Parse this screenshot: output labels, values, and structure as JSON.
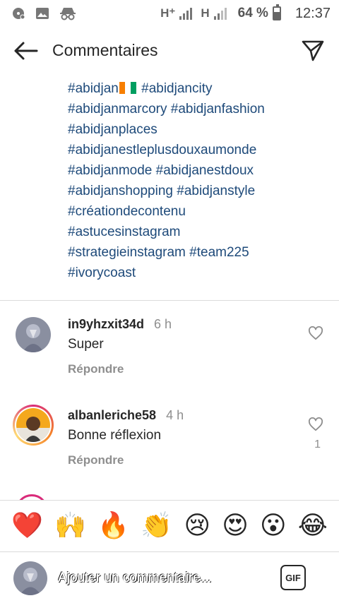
{
  "status_bar": {
    "network_1": "H⁺",
    "network_2": "H",
    "battery_percent": "64 %",
    "battery_level": 0.64,
    "time": "12:37"
  },
  "header": {
    "title": "Commentaires"
  },
  "caption": {
    "lines": [
      [
        "#abidjan",
        "#abidjancity"
      ],
      [
        "#abidjanmarcory",
        "#abidjanfashion"
      ],
      [
        "#abidjanplaces"
      ],
      [
        "#abidjanestleplusdouxaumonde"
      ],
      [
        "#abidjanmode",
        "#abidjanestdoux"
      ],
      [
        "#abidjanshopping",
        "#abidjanstyle"
      ],
      [
        "#créationdecontenu"
      ],
      [
        "#astucesinstagram"
      ],
      [
        "#strategieinstagram",
        "#team225"
      ],
      [
        "#ivorycoast"
      ]
    ],
    "flag_colors": [
      "#f77f00",
      "#ffffff",
      "#009e60"
    ]
  },
  "comments": [
    {
      "username": "in9yhzxit34d",
      "time": "6 h",
      "text": "Super",
      "reply_label": "Répondre",
      "likes": ""
    },
    {
      "username": "albanleriche58",
      "time": "4 h",
      "text": "Bonne réflexion",
      "reply_label": "Répondre",
      "likes": "1"
    }
  ],
  "emoji_bar": {
    "emojis": [
      "❤️",
      "🙌",
      "🔥",
      "👏",
      "😢",
      "😍",
      "😮",
      "😂"
    ]
  },
  "comment_input": {
    "placeholder": "Ajouter un commentaire...",
    "gif_label": "GIF"
  },
  "colors": {
    "hashtag": "#1e4a7a",
    "muted": "#8e8e8e",
    "story_ring": "#d92b7a"
  }
}
